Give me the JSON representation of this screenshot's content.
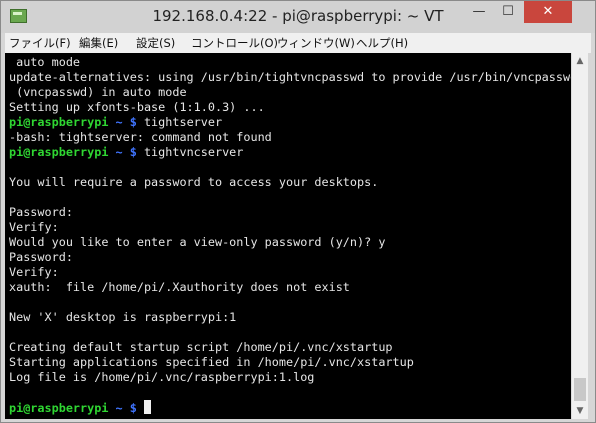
{
  "window": {
    "title": "192.168.0.4:22 - pi@raspberrypi: ~ VT"
  },
  "menu": [
    "ファイル(F)",
    "編集(E)",
    "設定(S)",
    "コントロール(O)",
    "ウィンドウ(W)",
    "ヘルプ(H)"
  ],
  "prompt": {
    "user": "pi@raspberrypi",
    "path": "~ $"
  },
  "terminal_lines": [
    {
      "type": "out",
      "text": " auto mode"
    },
    {
      "type": "out",
      "text": "update-alternatives: using /usr/bin/tightvncpasswd to provide /usr/bin/vncpasswd"
    },
    {
      "type": "out",
      "text": " (vncpasswd) in auto mode"
    },
    {
      "type": "out",
      "text": "Setting up xfonts-base (1:1.0.3) ..."
    },
    {
      "type": "cmd",
      "text": "tightserver"
    },
    {
      "type": "out",
      "text": "-bash: tightserver: command not found"
    },
    {
      "type": "cmd",
      "text": "tightvncserver"
    },
    {
      "type": "out",
      "text": ""
    },
    {
      "type": "out",
      "text": "You will require a password to access your desktops."
    },
    {
      "type": "out",
      "text": ""
    },
    {
      "type": "out",
      "text": "Password:"
    },
    {
      "type": "out",
      "text": "Verify:"
    },
    {
      "type": "out",
      "text": "Would you like to enter a view-only password (y/n)? y"
    },
    {
      "type": "out",
      "text": "Password:"
    },
    {
      "type": "out",
      "text": "Verify:"
    },
    {
      "type": "out",
      "text": "xauth:  file /home/pi/.Xauthority does not exist"
    },
    {
      "type": "out",
      "text": ""
    },
    {
      "type": "out",
      "text": "New 'X' desktop is raspberrypi:1"
    },
    {
      "type": "out",
      "text": ""
    },
    {
      "type": "out",
      "text": "Creating default startup script /home/pi/.vnc/xstartup"
    },
    {
      "type": "out",
      "text": "Starting applications specified in /home/pi/.vnc/xstartup"
    },
    {
      "type": "out",
      "text": "Log file is /home/pi/.vnc/raspberrypi:1.log"
    },
    {
      "type": "out",
      "text": ""
    },
    {
      "type": "cmd",
      "text": "",
      "cursor": true
    }
  ],
  "colors": {
    "background": "#000000",
    "foreground": "#e6e6e6",
    "prompt_user": "#2fd632",
    "prompt_path": "#3f74ff",
    "close_button": "#c9463d"
  },
  "icons": {
    "app": "terminal-app-icon",
    "minimize": "minimize-icon",
    "maximize": "maximize-icon",
    "close": "close-icon"
  }
}
